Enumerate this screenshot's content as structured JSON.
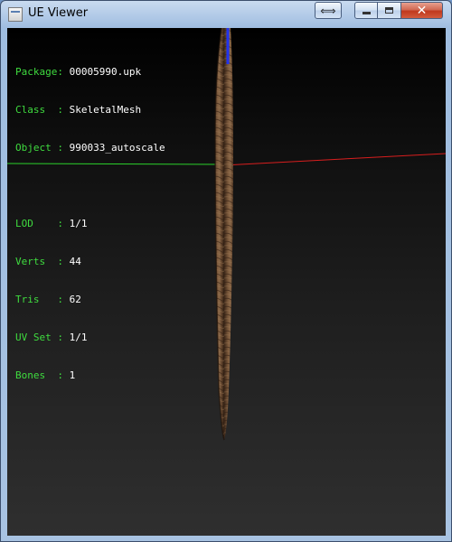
{
  "window": {
    "title": "UE Viewer",
    "controls": {
      "swap_icon": "⟺",
      "close_glyph": "✕"
    }
  },
  "info": {
    "package_label": "Package:",
    "package_value": "00005990.upk",
    "class_label": "Class  :",
    "class_value": "SkeletalMesh",
    "object_label": "Object :",
    "object_value": "990033_autoscale",
    "lod_label": "LOD    :",
    "lod_value": "1/1",
    "verts_label": "Verts  :",
    "verts_value": "44",
    "tris_label": "Tris   :",
    "tris_value": "62",
    "uvset_label": "UV Set :",
    "uvset_value": "1/1",
    "bones_label": "Bones  :",
    "bones_value": "1"
  },
  "colors": {
    "label_green": "#3fdc3f",
    "axis_x": "#d81e1e",
    "axis_y": "#2bd12b",
    "axis_z": "#2233ee",
    "mesh_brown": "#6b4c33"
  }
}
